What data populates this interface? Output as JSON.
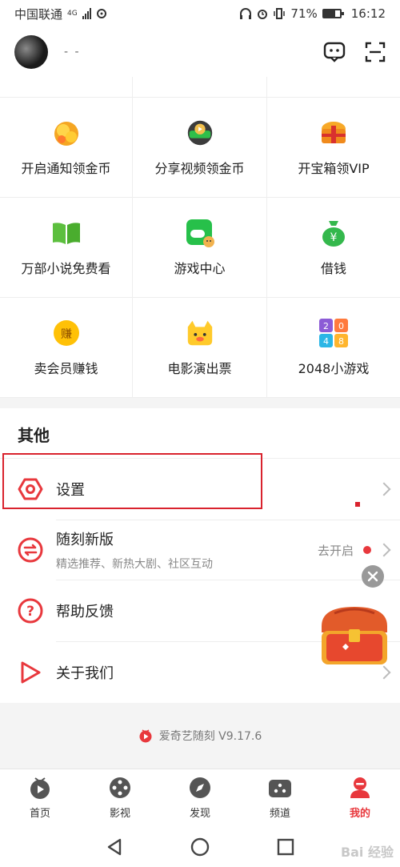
{
  "status": {
    "carrier": "中国联通",
    "network": "4G",
    "battery": "71%",
    "time": "16:12"
  },
  "header": {
    "username": "- -"
  },
  "grid": {
    "items": [
      {
        "label": "开启通知领金币",
        "icon": "gold-coins-icon"
      },
      {
        "label": "分享视频领金币",
        "icon": "share-video-icon"
      },
      {
        "label": "开宝箱领VIP",
        "icon": "treasure-chest-icon"
      },
      {
        "label": "万部小说免费看",
        "icon": "open-book-icon"
      },
      {
        "label": "游戏中心",
        "icon": "game-controller-icon"
      },
      {
        "label": "借钱",
        "icon": "money-bag-icon"
      },
      {
        "label": "卖会员赚钱",
        "icon": "earn-coin-icon"
      },
      {
        "label": "电影演出票",
        "icon": "cat-ticket-icon"
      },
      {
        "label": "2048小游戏",
        "icon": "game-2048-icon"
      }
    ]
  },
  "other": {
    "title": "其他",
    "settings": "设置",
    "suike_title": "随刻新版",
    "suike_sub": "精选推荐、新热大剧、社区互动",
    "suike_status": "去开启",
    "help": "帮助反馈",
    "about": "关于我们"
  },
  "version": "爱奇艺随刻 V9.17.6",
  "tabs": [
    "首页",
    "影视",
    "发现",
    "频道",
    "我的"
  ],
  "watermark": "Bai 经验",
  "colors": {
    "accent": "#e8383d",
    "highlight_box": "#d9232e"
  }
}
